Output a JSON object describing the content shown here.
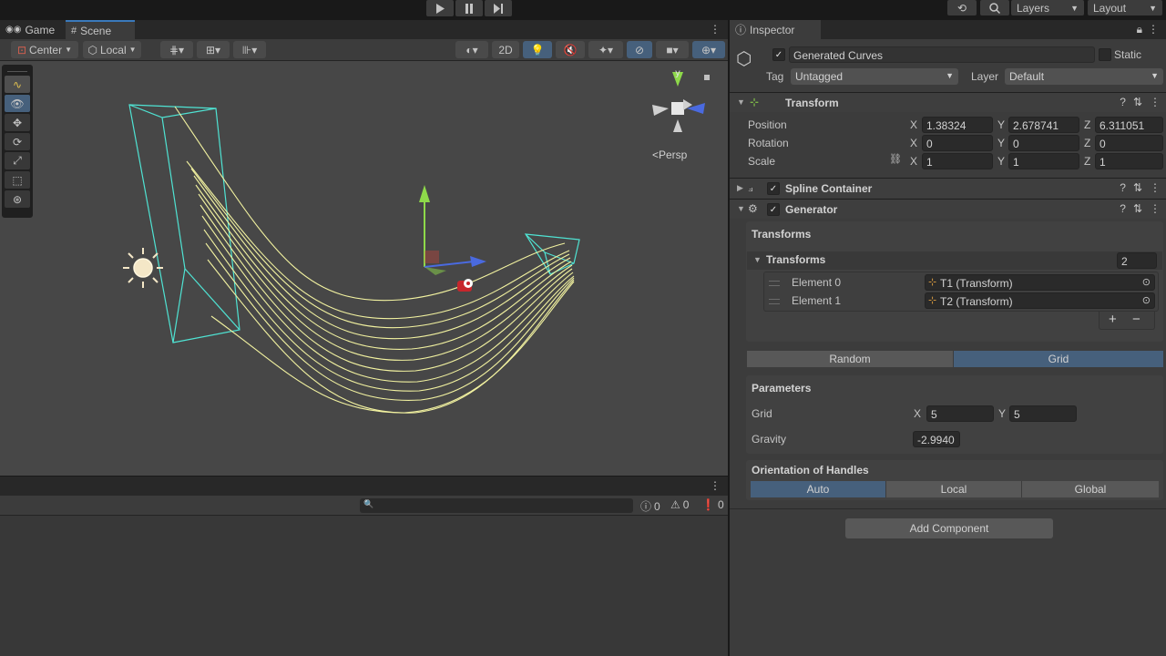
{
  "window": {
    "tabs": {
      "game": "Game",
      "scene": "Scene"
    },
    "top_right": {
      "layers": "Layers",
      "layout": "Layout"
    }
  },
  "scene_toolbar": {
    "pivot": "Center",
    "space": "Local",
    "mode_2d": "2D"
  },
  "viewport": {
    "gizmo_y": "y",
    "projection": "<Persp"
  },
  "console": {
    "counts": {
      "info": "0",
      "warnings": "0",
      "errors": "0"
    }
  },
  "inspector": {
    "tab": "Inspector",
    "object": {
      "name": "Generated Curves",
      "active": true,
      "static_label": "Static",
      "tag_label": "Tag",
      "tag_value": "Untagged",
      "layer_label": "Layer",
      "layer_value": "Default"
    },
    "transform": {
      "title": "Transform",
      "position_label": "Position",
      "rotation_label": "Rotation",
      "scale_label": "Scale",
      "position": {
        "x": "1.38324",
        "y": "2.678741",
        "z": "6.311051"
      },
      "rotation": {
        "x": "0",
        "y": "0",
        "z": "0"
      },
      "scale": {
        "x": "1",
        "y": "1",
        "z": "1"
      },
      "axes": {
        "x": "X",
        "y": "Y",
        "z": "Z"
      }
    },
    "spline_container": {
      "title": "Spline Container",
      "enabled": true
    },
    "generator": {
      "title": "Generator",
      "enabled": true,
      "transforms_section": "Transforms",
      "transforms_list_label": "Transforms",
      "transforms_count": "2",
      "elements": [
        {
          "label": "Element 0",
          "value": "T1 (Transform)"
        },
        {
          "label": "Element 1",
          "value": "T2 (Transform)"
        }
      ],
      "add_symbol": "+",
      "remove_symbol": "−",
      "modes": [
        "Random",
        "Grid"
      ],
      "selected_mode": "Grid",
      "parameters_label": "Parameters",
      "grid_label": "Grid",
      "grid_x": "5",
      "grid_y": "5",
      "gravity_label": "Gravity",
      "gravity_value": "-2.9940",
      "orientation_label": "Orientation of Handles",
      "orientation_options": [
        "Auto",
        "Local",
        "Global"
      ],
      "selected_orientation": "Auto"
    },
    "add_component": "Add Component"
  },
  "colors": {
    "accent_blue": "#46607c",
    "curve_yellow": "#f2f2a0",
    "bounds_cyan": "#4fe3d3",
    "gizmo_y_green": "#8ed94a",
    "gizmo_x_red": "#d8453a",
    "gizmo_z_blue": "#4a6ae0"
  }
}
